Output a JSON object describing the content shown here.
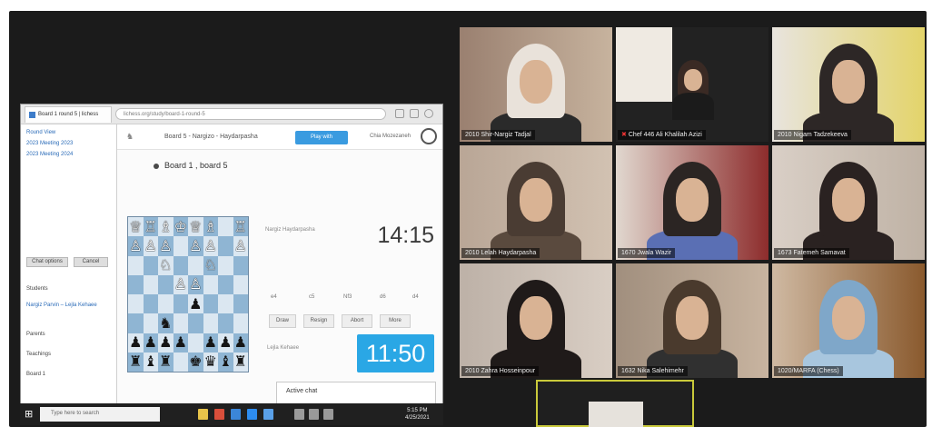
{
  "shared_screen": {
    "browser_tab": "Board 1 round 5 | lichess",
    "url": "lichess.org/study/board-1-round-5",
    "left_pane": {
      "items": [
        "Round View",
        "2023 Meeting 2023",
        "2023 Meeting 2024"
      ],
      "buttons": [
        "Chat options",
        "Cancel"
      ],
      "sections": [
        "Students",
        "Nargiz Parvin – Lejla Kehaee",
        "Parents",
        "Teachings",
        "Board 1"
      ]
    },
    "app": {
      "logo": "♞",
      "header_title": "Board 5 - Nargizo - Haydarpasha",
      "play_button": "Play with",
      "username": "Chia Mozezaneh",
      "board_title": "Board 1 , board 5",
      "player_top": "Nargiz Haydarpasha",
      "player_bottom": "Lejla Kehaee",
      "clock_top": "14:15",
      "clock_bottom": "11:50",
      "moves": [
        "e4",
        "c5",
        "Nf3",
        "d6",
        "d4"
      ],
      "buttons": [
        "Draw",
        "Resign",
        "Abort",
        "More"
      ],
      "chat_popup": "Active chat"
    },
    "taskbar": {
      "search_placeholder": "Type here to search",
      "time": "5:15 PM",
      "date": "4/25/2021"
    }
  },
  "participants": [
    {
      "name": "2010 Shir-Nargiz Tadjal",
      "muted": false
    },
    {
      "name": "Chef 446 Ali Khalilah Azizi",
      "muted": true
    },
    {
      "name": "2010 Nigam Tadzekeeva",
      "muted": false
    },
    {
      "name": "2010 Lelah Haydarpasha",
      "muted": false
    },
    {
      "name": "1670 Jwala Wazir",
      "muted": false
    },
    {
      "name": "1673 Fatemeh Samavat",
      "muted": false
    },
    {
      "name": "2010 Zahra Hosseinpour",
      "muted": false
    },
    {
      "name": "1632 Nika Salehimehr",
      "muted": false
    },
    {
      "name": "1020/MARFA (Chess)",
      "muted": false
    }
  ],
  "board_position": [
    [
      "♕",
      "♖",
      "♗",
      "♔",
      "♕",
      "♗",
      "",
      "♖"
    ],
    [
      "♙",
      "♙",
      "♙",
      "",
      "♙",
      "♙",
      "",
      "♙"
    ],
    [
      "",
      "",
      "♘",
      "",
      "",
      "♘",
      "",
      ""
    ],
    [
      "",
      "",
      "",
      "♙",
      "♙",
      "",
      "",
      ""
    ],
    [
      "",
      "",
      "",
      "",
      "♟",
      "",
      "",
      ""
    ],
    [
      "",
      "",
      "♞",
      "",
      "",
      "",
      "",
      ""
    ],
    [
      "♟",
      "♟",
      "♟",
      "♟",
      "",
      "♟",
      "♟",
      "♟"
    ],
    [
      "♜",
      "♝",
      "♜",
      "",
      "♚",
      "♛",
      "♝",
      "♜"
    ]
  ],
  "colors": {
    "stage": "#1b1b1b",
    "board_light": "#dbe7f1",
    "board_dark": "#8fb5d3",
    "clock_active": "#2aa7e5",
    "self_view_border": "#c9c93a"
  }
}
